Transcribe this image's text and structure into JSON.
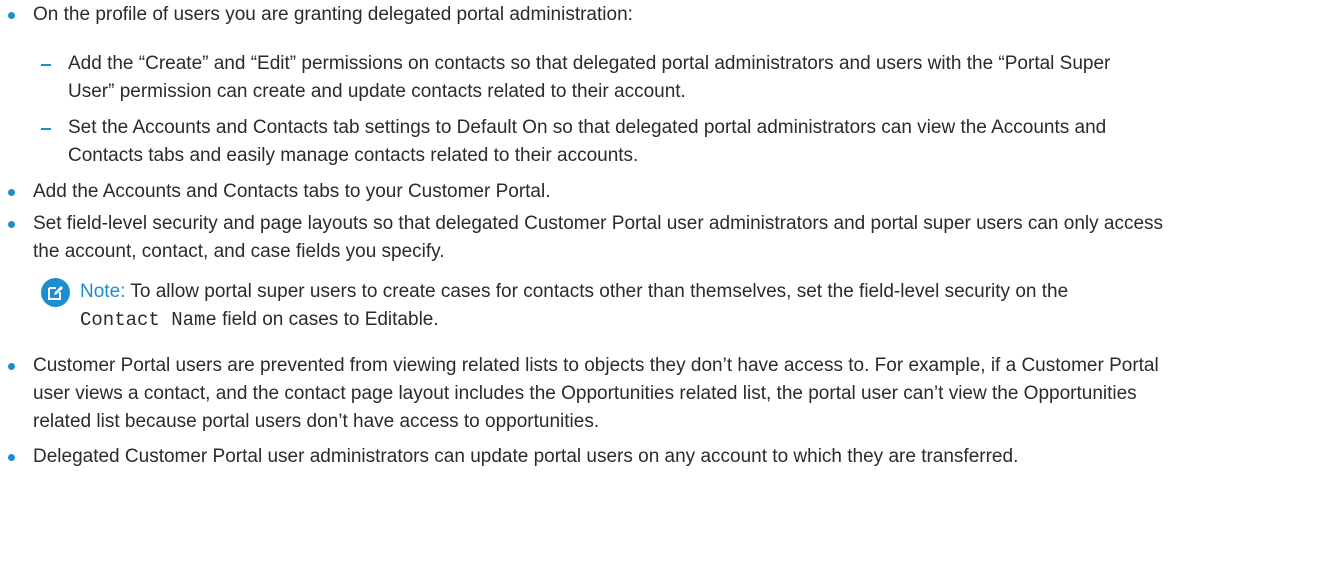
{
  "items": {
    "i1": {
      "line1": "On the profile of users you are granting delegated portal administration:"
    },
    "s1": {
      "line1": "Add the “Create” and “Edit” permissions on contacts so that delegated portal administrators and users with the “Portal Super",
      "line2": "User” permission can create and update contacts related to their account."
    },
    "s2": {
      "line1": "Set the Accounts and Contacts tab settings to Default On so that delegated portal administrators can view the Accounts and",
      "line2": "Contacts tabs and easily manage contacts related to their accounts."
    },
    "i2": {
      "line1": "Add the Accounts and Contacts tabs to your Customer Portal."
    },
    "i3": {
      "line1": "Set field-level security and page layouts so that delegated Customer Portal user administrators and portal super users can only access",
      "line2": "the account, contact, and case fields you specify."
    },
    "note": {
      "label": "Note:",
      "line1": "To allow portal super users to create cases for contacts other than themselves, set the field-level security on the",
      "code": "Contact Name",
      "line2_rest": "field on cases to Editable."
    },
    "i4": {
      "line1": "Customer Portal users are prevented from viewing related lists to objects they don’t have access to. For example, if a Customer Portal",
      "line2": "user views a contact, and the contact page layout includes the Opportunities related list, the portal user can’t view the Opportunities",
      "line3": "related list because portal users don’t have access to opportunities."
    },
    "i5": {
      "line1": "Delegated Customer Portal user administrators can update portal users on any account to which they are transferred."
    }
  },
  "colors": {
    "accent": "#1a8ed1",
    "text": "#2b2b2b"
  },
  "icons": {
    "note": "edit-note-icon"
  }
}
